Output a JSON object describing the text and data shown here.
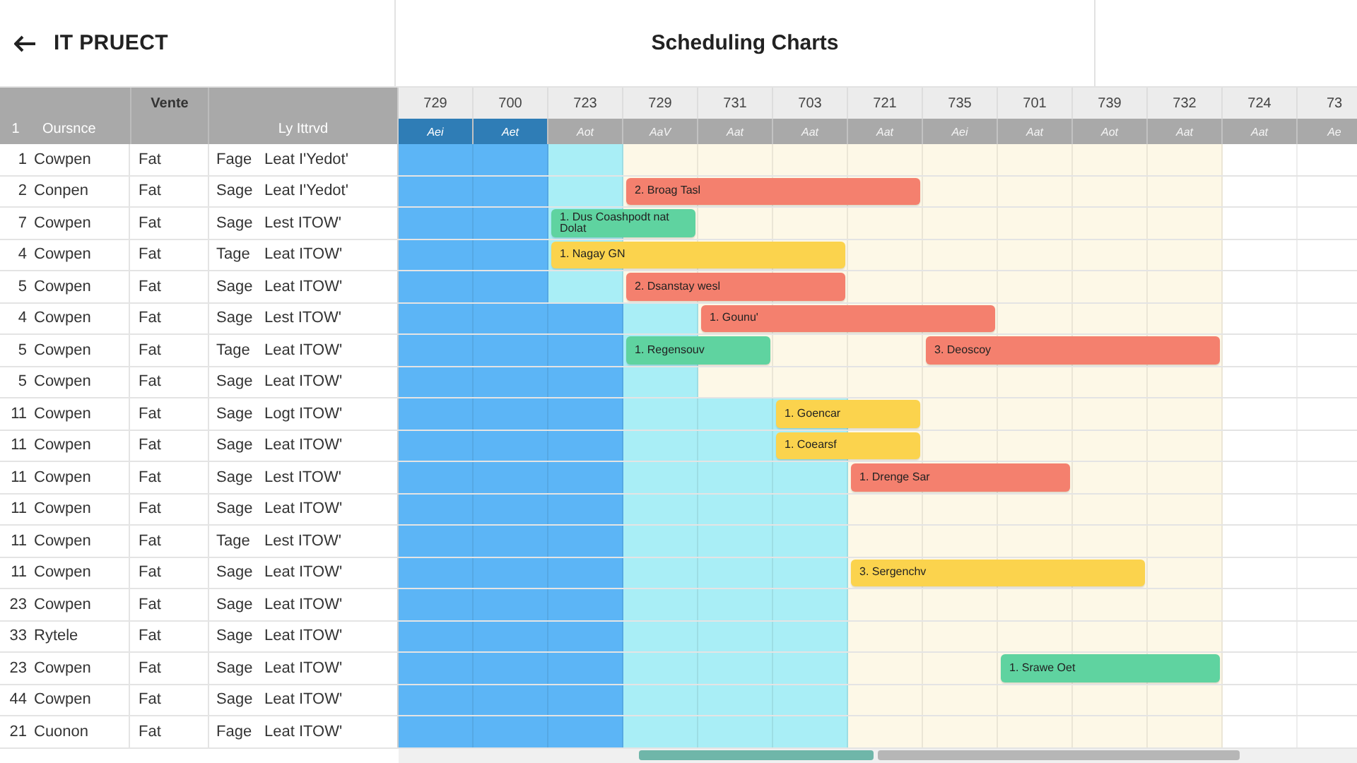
{
  "header": {
    "project": "IT PRUECT",
    "title": "Scheduling Charts"
  },
  "table_headers": {
    "number": "1",
    "name": "Oursnce",
    "column_3": "Vente",
    "column_4": "Ly Ittrvd"
  },
  "columns": [
    {
      "date": "729",
      "sub": "Aei",
      "selected": true
    },
    {
      "date": "700",
      "sub": "Aet",
      "selected": true
    },
    {
      "date": "723",
      "sub": "Aot",
      "selected": false
    },
    {
      "date": "729",
      "sub": "AaV",
      "selected": false
    },
    {
      "date": "731",
      "sub": "Aat",
      "selected": false
    },
    {
      "date": "703",
      "sub": "Aat",
      "selected": false
    },
    {
      "date": "721",
      "sub": "Aat",
      "selected": false
    },
    {
      "date": "735",
      "sub": "Aei",
      "selected": false
    },
    {
      "date": "701",
      "sub": "Aat",
      "selected": false
    },
    {
      "date": "739",
      "sub": "Aot",
      "selected": false
    },
    {
      "date": "732",
      "sub": "Aat",
      "selected": false
    },
    {
      "date": "724",
      "sub": "Aat",
      "selected": false
    },
    {
      "date": "73",
      "sub": "Ae",
      "selected": false
    }
  ],
  "rows": [
    {
      "number": "1",
      "name": "Cowpen",
      "column_3": "Fat",
      "column_4a": "Fage",
      "column_4b": "Leat I'Yedot'",
      "kind": "early"
    },
    {
      "number": "2",
      "name": "Conpen",
      "column_3": "Fat",
      "column_4a": "Sage",
      "column_4b": "Leat I'Yedot'",
      "kind": "early",
      "bars": [
        {
          "label": "2. Broag Tasl",
          "color": "#f4806e",
          "cover": [
            false,
            false,
            false,
            true,
            true,
            true,
            true,
            false,
            false,
            false,
            false,
            false,
            false
          ]
        }
      ]
    },
    {
      "number": "7",
      "name": "Cowpen",
      "column_3": "Fat",
      "column_4a": "Sage",
      "column_4b": "Lest ITOW'",
      "kind": "early",
      "bars": [
        {
          "label": "1. Dus Coashpodt nat Dolat",
          "color": "#5fd3a0",
          "cover": [
            false,
            false,
            true,
            true,
            false,
            false,
            false,
            false,
            false,
            false,
            false,
            false,
            false
          ]
        }
      ]
    },
    {
      "number": "4",
      "name": "Cowpen",
      "column_3": "Fat",
      "column_4a": "Tage",
      "column_4b": "Leat ITOW'",
      "kind": "early",
      "bars": [
        {
          "label": "1. Nagay GN",
          "color": "#fbd34d",
          "cover": [
            false,
            false,
            true,
            true,
            true,
            true,
            false,
            false,
            false,
            false,
            false,
            false,
            false
          ]
        }
      ]
    },
    {
      "number": "5",
      "name": "Cowpen",
      "column_3": "Fat",
      "column_4a": "Sage",
      "column_4b": "Leat ITOW'",
      "kind": "early",
      "bars": [
        {
          "label": "2. Dsanstay wesl",
          "color": "#f4806e",
          "cover": [
            false,
            false,
            false,
            true,
            true,
            true,
            false,
            false,
            false,
            false,
            false,
            false,
            false
          ]
        }
      ]
    },
    {
      "number": "4",
      "name": "Cowpen",
      "column_3": "Fat",
      "column_4a": "Sage",
      "column_4b": "Lest ITOW'",
      "kind": "middle",
      "bars": [
        {
          "label": "1. Gounu'",
          "color": "#f4806e",
          "cover": [
            false,
            false,
            false,
            false,
            true,
            true,
            true,
            true,
            false,
            false,
            false,
            false,
            false
          ]
        }
      ]
    },
    {
      "number": "5",
      "name": "Cowpen",
      "column_3": "Fat",
      "column_4a": "Tage",
      "column_4b": "Leat ITOW'",
      "kind": "middle",
      "bars": [
        {
          "label": "1. Regensouv",
          "color": "#5fd3a0",
          "cover": [
            false,
            false,
            false,
            true,
            true,
            false,
            false,
            false,
            false,
            false,
            false,
            false,
            false
          ]
        },
        {
          "label": "3. Deoscoy",
          "color": "#f4806e",
          "cover": [
            false,
            false,
            false,
            false,
            false,
            false,
            false,
            true,
            true,
            true,
            true,
            false,
            false
          ]
        }
      ]
    },
    {
      "number": "5",
      "name": "Cowpen",
      "column_3": "Fat",
      "column_4a": "Sage",
      "column_4b": "Leat ITOW'",
      "kind": "middle"
    },
    {
      "number": "11",
      "name": "Cowpen",
      "column_3": "Fat",
      "column_4a": "Sage",
      "column_4b": "Logt ITOW'",
      "kind": "late",
      "bars": [
        {
          "label": "1. Goencar",
          "color": "#fbd34d",
          "cover": [
            false,
            false,
            false,
            false,
            false,
            true,
            true,
            false,
            false,
            false,
            false,
            false,
            false
          ]
        }
      ]
    },
    {
      "number": "11",
      "name": "Cowpen",
      "column_3": "Fat",
      "column_4a": "Sage",
      "column_4b": "Leat ITOW'",
      "kind": "late",
      "bars": [
        {
          "label": "1. Coearsf",
          "color": "#fbd34d",
          "cover": [
            false,
            false,
            false,
            false,
            false,
            true,
            true,
            false,
            false,
            false,
            false,
            false,
            false
          ]
        }
      ]
    },
    {
      "number": "11",
      "name": "Cowpen",
      "column_3": "Fat",
      "column_4a": "Sage",
      "column_4b": "Lest ITOW'",
      "kind": "late",
      "bars": [
        {
          "label": "1. Drenge Sar",
          "color": "#f4806e",
          "cover": [
            false,
            false,
            false,
            false,
            false,
            false,
            true,
            true,
            true,
            false,
            false,
            false,
            false
          ]
        }
      ]
    },
    {
      "number": "11",
      "name": "Cowpen",
      "column_3": "Fat",
      "column_4a": "Sage",
      "column_4b": "Leat ITOW'",
      "kind": "late"
    },
    {
      "number": "11",
      "name": "Cowpen",
      "column_3": "Fat",
      "column_4a": "Tage",
      "column_4b": "Lest ITOW'",
      "kind": "late"
    },
    {
      "number": "11",
      "name": "Cowpen",
      "column_3": "Fat",
      "column_4a": "Sage",
      "column_4b": "Leat ITOW'",
      "kind": "late",
      "bars": [
        {
          "label": "3. Sergenchv",
          "color": "#fbd34d",
          "cover": [
            false,
            false,
            false,
            false,
            false,
            false,
            true,
            true,
            true,
            true,
            false,
            false,
            false
          ]
        }
      ]
    },
    {
      "number": "23",
      "name": "Cowpen",
      "column_3": "Fat",
      "column_4a": "Sage",
      "column_4b": "Leat ITOW'",
      "kind": "late"
    },
    {
      "number": "33",
      "name": "Rytele",
      "column_3": "Fat",
      "column_4a": "Sage",
      "column_4b": "Leat ITOW'",
      "kind": "late"
    },
    {
      "number": "23",
      "name": "Cowpen",
      "column_3": "Fat",
      "column_4a": "Sage",
      "column_4b": "Leat ITOW'",
      "kind": "late",
      "bars": [
        {
          "label": "1. Srawe Oet",
          "color": "#5fd3a0",
          "cover": [
            false,
            false,
            false,
            false,
            false,
            false,
            false,
            false,
            true,
            true,
            true,
            false,
            false
          ]
        }
      ]
    },
    {
      "number": "44",
      "name": "Cowpen",
      "column_3": "Fat",
      "column_4a": "Sage",
      "column_4b": "Leat ITOW'",
      "kind": "late"
    },
    {
      "number": "21",
      "name": "Cuonon",
      "column_3": "Fat",
      "column_4a": "Fage",
      "column_4b": "Leat ITOW'",
      "kind": "late"
    }
  ]
}
